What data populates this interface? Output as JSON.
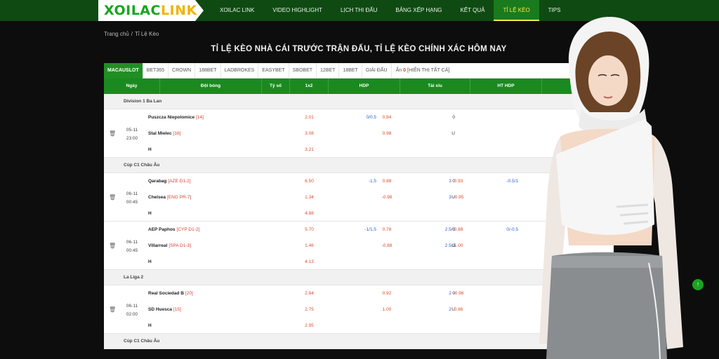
{
  "logo": {
    "part1": "XOILAC",
    "part2": "LINK"
  },
  "nav": [
    {
      "label": "XOILAC LINK",
      "active": false
    },
    {
      "label": "VIDEO HIGHLIGHT",
      "active": false
    },
    {
      "label": "LỊCH THI ĐẤU",
      "active": false
    },
    {
      "label": "BẢNG XẾP HẠNG",
      "active": false
    },
    {
      "label": "KẾT QUẢ",
      "active": false
    },
    {
      "label": "TỈ LỆ KÈO",
      "active": true
    },
    {
      "label": "TIPS",
      "active": false
    }
  ],
  "breadcrumb": {
    "home": "Trang chủ",
    "separator": "/",
    "current": "Tỉ Lệ Kèo"
  },
  "page_title": "TỈ LỆ KÈO NHÀ CÁI TRƯỚC TRẬN ĐẤU, TỈ LỆ KÈO CHÍNH XÁC HÔM NAY",
  "bookmakers": [
    "MACAUSLOT",
    "BET365",
    "CROWN",
    "188BET",
    "LADBROKES",
    "EASYBET",
    "SBOBET",
    "12BET",
    "18BET",
    "GIẢI ĐẤU"
  ],
  "hidden": {
    "prefix": "Ẩn",
    "count": "0",
    "link": "[HIỂN THỊ TẤT CẢ]"
  },
  "columns": {
    "date": "Ngày",
    "teams": "Đội bóng",
    "score": "Tỷ số",
    "x12": "1x2",
    "hdp": "HDP",
    "ou": "Tài xỉu",
    "hthdp": "HT HDP"
  },
  "leagues": [
    {
      "name": "Division 1 Ba Lan",
      "matches": [
        {
          "date": "05-11",
          "time": "23:00",
          "home": "Puszcza Niepolomice",
          "home_rank": "[14]",
          "away": "Stal Mielec",
          "away_rank": "[16]",
          "draw": "H",
          "o1x2": [
            "2.01",
            "3.08",
            "3.21"
          ],
          "hdp": [
            "0/0.5",
            ""
          ],
          "hdp_odds": [
            "0.84",
            "0.98"
          ],
          "ou": [
            "0",
            "U"
          ],
          "ou_line": [
            "",
            ""
          ],
          "ou_odds": [
            "",
            ""
          ],
          "ht": [
            "",
            ""
          ],
          "ht_odds": [
            "",
            ""
          ]
        }
      ]
    },
    {
      "name": "Cúp C1 Châu Âu",
      "matches": [
        {
          "date": "06-11",
          "time": "00:45",
          "home": "Qarabag",
          "home_rank": "[AZE D1-2]",
          "away": "Chelsea",
          "away_rank": "[ENG PR-7]",
          "draw": "H",
          "o1x2": [
            "6.50",
            "1.34",
            "4.88"
          ],
          "hdp": [
            "-1.5",
            ""
          ],
          "hdp_odds": [
            "0.88",
            "-0.98"
          ],
          "ou": [
            "0",
            "U"
          ],
          "ou_line": [
            "3",
            "3"
          ],
          "ou_odds": [
            "0.93",
            "-0.95"
          ],
          "ht": [
            "-0.5/1",
            ""
          ],
          "ht_odds": [
            "",
            ""
          ]
        },
        {
          "date": "06-11",
          "time": "00:45",
          "home": "AEP Paphos",
          "home_rank": "[CYP D1-2]",
          "away": "Villarreal",
          "away_rank": "[SPA D1-3]",
          "draw": "H",
          "o1x2": [
            "5.70",
            "1.46",
            "4.13"
          ],
          "hdp": [
            "-1/1.5",
            ""
          ],
          "hdp_odds": [
            "0.78",
            "-0.88"
          ],
          "ou": [
            "0",
            "U"
          ],
          "ou_line": [
            "2.5/3",
            "2.5/3"
          ],
          "ou_odds": [
            "0.88",
            "1.00"
          ],
          "ht": [
            "0/-0.5",
            ""
          ],
          "ht_odds": [
            "",
            ""
          ]
        }
      ]
    },
    {
      "name": "La Liga 2",
      "matches": [
        {
          "date": "06-11",
          "time": "02:00",
          "home": "Real Sociedad B",
          "home_rank": "[20]",
          "away": "SD Huesca",
          "away_rank": "[15]",
          "draw": "H",
          "o1x2": [
            "2.84",
            "2.75",
            "2.95"
          ],
          "hdp": [
            "",
            ""
          ],
          "hdp_odds": [
            "0.92",
            "1.00"
          ],
          "ou": [
            "0",
            "U"
          ],
          "ou_line": [
            "2",
            "2"
          ],
          "ou_odds": [
            "-0.96",
            "0.86"
          ],
          "ht": [
            "",
            ""
          ],
          "ht_odds": [
            "",
            ""
          ]
        }
      ]
    },
    {
      "name": "Cúp C1 Châu Âu",
      "matches": []
    }
  ],
  "scroll_top_icon": "arrow-up-icon"
}
